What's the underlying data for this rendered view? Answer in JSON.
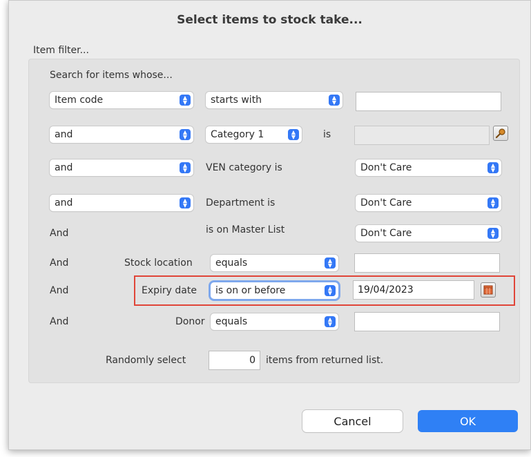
{
  "dialog": {
    "title": "Select items to stock take...",
    "filter_group_label": "Item filter...",
    "search_prefix": "Search for items whose..."
  },
  "rows": {
    "row1": {
      "field": "Item code",
      "operator": "starts with",
      "value": ""
    },
    "row2": {
      "conjunction": "and",
      "field": "Category 1",
      "is_label": "is",
      "value": ""
    },
    "row3": {
      "conjunction": "and",
      "label": "VEN category is",
      "value": "Don't Care"
    },
    "row4": {
      "conjunction": "and",
      "label": "Department is",
      "value": "Don't Care"
    },
    "row5": {
      "conjunction": "And",
      "label": "is on Master List",
      "value": "Don't Care"
    },
    "row6": {
      "conjunction": "And",
      "label": "Stock location",
      "operator": "equals",
      "value": ""
    },
    "row7": {
      "conjunction": "And",
      "label": "Expiry date",
      "operator": "is on or before",
      "value": "19/04/2023"
    },
    "row8": {
      "conjunction": "And",
      "label": "Donor",
      "operator": "equals",
      "value": ""
    }
  },
  "random": {
    "prefix": "Randomly select",
    "count": "0",
    "suffix": "items from returned list."
  },
  "buttons": {
    "cancel": "Cancel",
    "ok": "OK"
  },
  "icons": {
    "search": "magnifier-icon",
    "calendar": "calendar-icon",
    "chevron": "updown-chevron-icon"
  },
  "colors": {
    "accent": "#2f80f5",
    "highlight": "#e04538"
  }
}
